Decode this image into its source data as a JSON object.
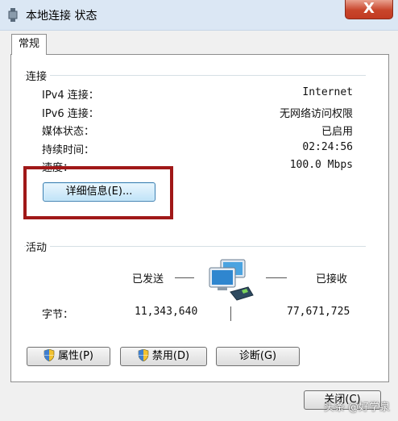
{
  "window": {
    "title": "本地连接 状态",
    "close_label": "X"
  },
  "tabs": [
    {
      "label": "常规"
    }
  ],
  "connection": {
    "heading": "连接",
    "rows": [
      {
        "label": "IPv4 连接：",
        "value": "Internet"
      },
      {
        "label": "IPv6 连接：",
        "value": "无网络访问权限"
      },
      {
        "label": "媒体状态：",
        "value": "已启用"
      },
      {
        "label": "持续时间：",
        "value": "02:24:56"
      },
      {
        "label": "速度：",
        "value": "100.0 Mbps"
      }
    ],
    "details_button": "详细信息(E)..."
  },
  "activity": {
    "heading": "活动",
    "sent_label": "已发送",
    "received_label": "已接收",
    "bytes_label": "字节：",
    "bytes_sent": "11,343,640",
    "bytes_received": "77,671,725"
  },
  "buttons": {
    "properties": "属性(P)",
    "disable": "禁用(D)",
    "diagnose": "诊断(G)",
    "close": "关闭(C)"
  },
  "watermark": "头条 @好学泉",
  "icons": {
    "title": "network-connection-icon",
    "activity": "network-computers-icon",
    "shield": "uac-shield-icon"
  },
  "colors": {
    "highlight_border": "#a01818",
    "close_button": "#c8452b",
    "focused_button": "#3c7fb1"
  }
}
